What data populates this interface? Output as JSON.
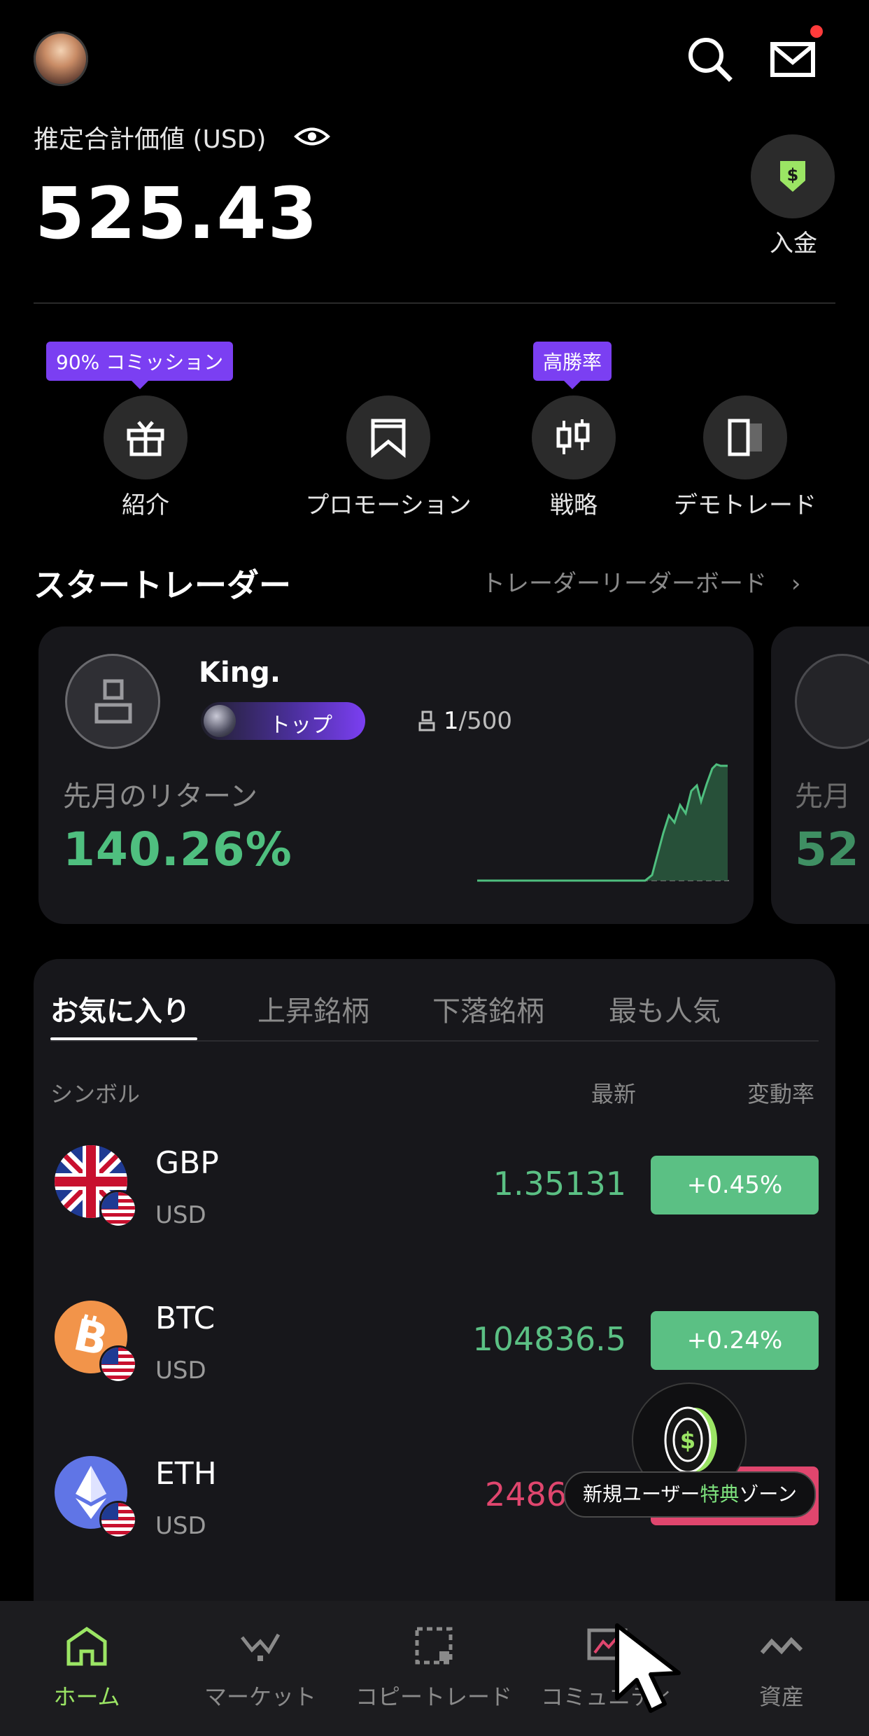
{
  "header": {
    "total_label": "推定合計価値 (USD)",
    "total_value": "525.43",
    "deposit_label": "入金",
    "notification_dot": true
  },
  "quick_actions": [
    {
      "label": "紹介",
      "badge": "90% コミッション",
      "icon": "gift-icon"
    },
    {
      "label": "プロモーション",
      "badge": "",
      "icon": "promotion-icon"
    },
    {
      "label": "戦略",
      "badge": "高勝率",
      "icon": "candlestick-icon"
    },
    {
      "label": "デモトレード",
      "badge": "",
      "icon": "demo-icon"
    }
  ],
  "star_traders": {
    "title": "スタートレーダー",
    "leaderboard_link": "トレーダーリーダーボード",
    "card": {
      "name": "King.",
      "rank_badge": "トップ",
      "followers_current": "1",
      "followers_max": "/500",
      "return_label": "先月のリターン",
      "return_value": "140.26%"
    },
    "card2": {
      "return_label_partial": "先月",
      "return_value_partial": "52"
    }
  },
  "market": {
    "tabs": [
      "お気に入り",
      "上昇銘柄",
      "下落銘柄",
      "最も人気"
    ],
    "active_tab": 0,
    "columns": {
      "symbol": "シンボル",
      "latest": "最新",
      "change": "変動率"
    },
    "rows": [
      {
        "symbol": "GBP",
        "quote": "USD",
        "price": "1.35131",
        "change": "+0.45%",
        "direction": "up",
        "icon": "uk-flag-icon"
      },
      {
        "symbol": "BTC",
        "quote": "USD",
        "price": "104836.5",
        "change": "+0.24%",
        "direction": "up",
        "icon": "bitcoin-icon"
      },
      {
        "symbol": "ETH",
        "quote": "USD",
        "price": "2486",
        "change": "",
        "direction": "down",
        "icon": "ethereum-icon"
      }
    ]
  },
  "promo": {
    "text_before": "新規ユーザー",
    "text_highlight": "特典",
    "text_after": "ゾーン"
  },
  "bottom_nav": [
    {
      "label": "ホーム",
      "icon": "home-icon",
      "active": true
    },
    {
      "label": "マーケット",
      "icon": "market-icon",
      "active": false
    },
    {
      "label": "コピートレード",
      "icon": "copy-trade-icon",
      "active": false
    },
    {
      "label": "コミュニティ",
      "icon": "community-icon",
      "active": false
    },
    {
      "label": "資産",
      "icon": "assets-icon",
      "active": false
    }
  ],
  "colors": {
    "up": "#5bc084",
    "down": "#e0466e",
    "accent": "#7b3ff2",
    "nav_active": "#9be564"
  }
}
